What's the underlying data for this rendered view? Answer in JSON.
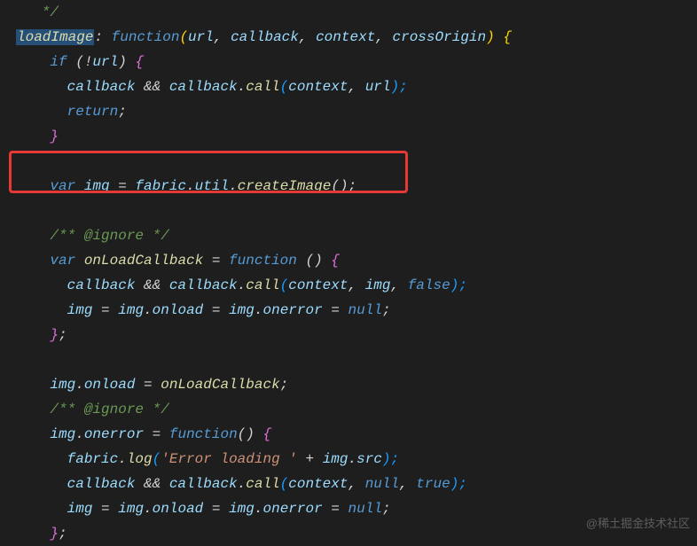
{
  "code": {
    "l0": "   */",
    "l1_sel": "loadImage",
    "l1_a": ": ",
    "l1_b": "function",
    "l1_c": "(",
    "l1_p1": "url",
    "l1_p2": "callback",
    "l1_p3": "context",
    "l1_p4": "crossOrigin",
    "l1_d": ") ",
    "l1_e": "{",
    "l2_a": "    ",
    "l2_b": "if",
    "l2_c": " (!",
    "l2_d": "url",
    "l2_e": ") ",
    "l2_f": "{",
    "l3_a": "      ",
    "l3_b": "callback",
    "l3_c": " && ",
    "l3_d": "callback",
    "l3_e": ".",
    "l3_f": "call",
    "l3_g": "(",
    "l3_h": "context",
    "l3_i": ", ",
    "l3_j": "url",
    "l3_k": ");",
    "l4_a": "      ",
    "l4_b": "return",
    "l4_c": ";",
    "l5_a": "    ",
    "l5_b": "}",
    "l6": " ",
    "l7_a": "    ",
    "l7_b": "var",
    "l7_c": " ",
    "l7_d": "img",
    "l7_e": " = ",
    "l7_f": "fabric",
    "l7_g": ".",
    "l7_h": "util",
    "l7_i": ".",
    "l7_j": "createImage",
    "l7_k": "();",
    "l8": " ",
    "l9_a": "    ",
    "l9_b": "/** @ignore */",
    "l10_a": "    ",
    "l10_b": "var",
    "l10_c": " ",
    "l10_d": "onLoadCallback",
    "l10_e": " = ",
    "l10_f": "function",
    "l10_g": " () ",
    "l10_h": "{",
    "l11_a": "      ",
    "l11_b": "callback",
    "l11_c": " && ",
    "l11_d": "callback",
    "l11_e": ".",
    "l11_f": "call",
    "l11_g": "(",
    "l11_h": "context",
    "l11_i": ", ",
    "l11_j": "img",
    "l11_k": ", ",
    "l11_l": "false",
    "l11_m": ");",
    "l12_a": "      ",
    "l12_b": "img",
    "l12_c": " = ",
    "l12_d": "img",
    "l12_e": ".",
    "l12_f": "onload",
    "l12_g": " = ",
    "l12_h": "img",
    "l12_i": ".",
    "l12_j": "onerror",
    "l12_k": " = ",
    "l12_l": "null",
    "l12_m": ";",
    "l13_a": "    ",
    "l13_b": "}",
    "l13_c": ";",
    "l14": " ",
    "l15_a": "    ",
    "l15_b": "img",
    "l15_c": ".",
    "l15_d": "onload",
    "l15_e": " = ",
    "l15_f": "onLoadCallback",
    "l15_g": ";",
    "l16_a": "    ",
    "l16_b": "/** @ignore */",
    "l17_a": "    ",
    "l17_b": "img",
    "l17_c": ".",
    "l17_d": "onerror",
    "l17_e": " = ",
    "l17_f": "function",
    "l17_g": "() ",
    "l17_h": "{",
    "l18_a": "      ",
    "l18_b": "fabric",
    "l18_c": ".",
    "l18_d": "log",
    "l18_e": "(",
    "l18_f": "'Error loading '",
    "l18_g": " + ",
    "l18_h": "img",
    "l18_i": ".",
    "l18_j": "src",
    "l18_k": ");",
    "l19_a": "      ",
    "l19_b": "callback",
    "l19_c": " && ",
    "l19_d": "callback",
    "l19_e": ".",
    "l19_f": "call",
    "l19_g": "(",
    "l19_h": "context",
    "l19_i": ", ",
    "l19_j": "null",
    "l19_k": ", ",
    "l19_l": "true",
    "l19_m": ");",
    "l20_a": "      ",
    "l20_b": "img",
    "l20_c": " = ",
    "l20_d": "img",
    "l20_e": ".",
    "l20_f": "onload",
    "l20_g": " = ",
    "l20_h": "img",
    "l20_i": ".",
    "l20_j": "onerror",
    "l20_k": " = ",
    "l20_l": "null",
    "l20_m": ";",
    "l21_a": "    ",
    "l21_b": "}",
    "l21_c": ";"
  },
  "watermark": "@稀土掘金技术社区"
}
